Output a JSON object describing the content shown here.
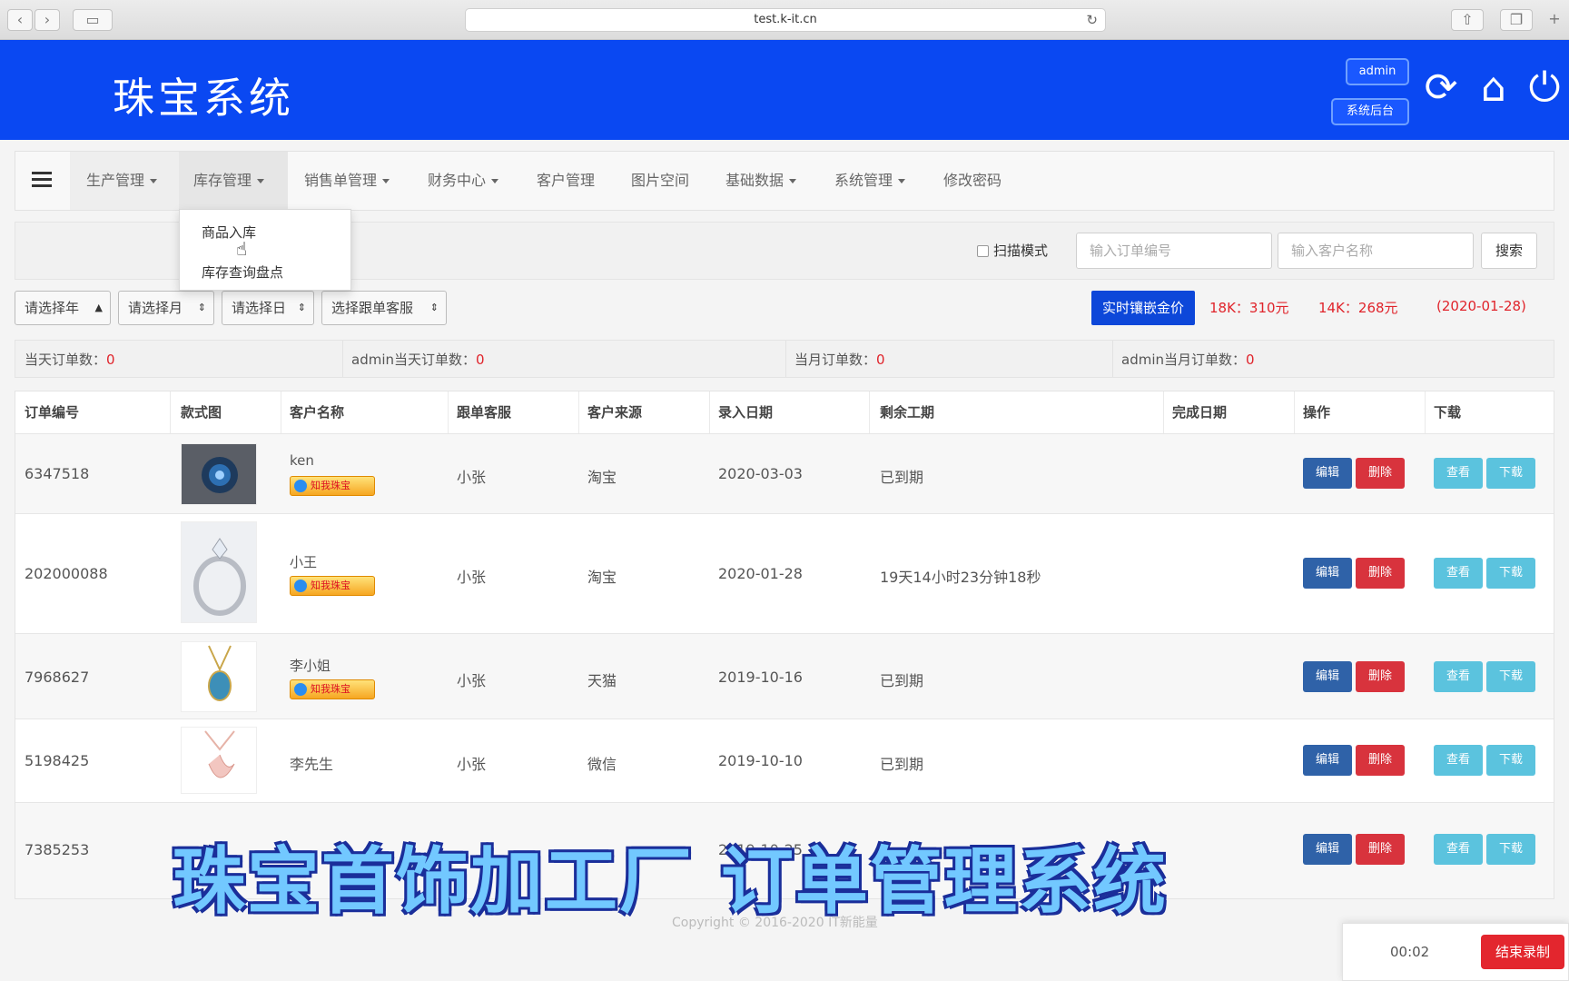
{
  "browser": {
    "url": "test.k-it.cn"
  },
  "header": {
    "title": "珠宝系统",
    "admin_label": "admin",
    "backend_label": "系统后台",
    "icons": [
      "refresh-icon",
      "home-icon",
      "power-icon"
    ]
  },
  "nav": {
    "items": [
      {
        "label": "生产管理",
        "dropdown": true
      },
      {
        "label": "库存管理",
        "dropdown": true,
        "active": true
      },
      {
        "label": "销售单管理",
        "dropdown": true
      },
      {
        "label": "财务中心",
        "dropdown": true
      },
      {
        "label": "客户管理",
        "dropdown": false
      },
      {
        "label": "图片空间",
        "dropdown": false
      },
      {
        "label": "基础数据",
        "dropdown": true
      },
      {
        "label": "系统管理",
        "dropdown": true
      },
      {
        "label": "修改密码",
        "dropdown": false
      }
    ],
    "open_dropdown": [
      "商品入库",
      "库存查询盘点"
    ]
  },
  "search": {
    "scan_mode_label": "扫描模式",
    "order_placeholder": "输入订单编号",
    "customer_placeholder": "输入客户名称",
    "button_label": "搜索"
  },
  "filters": {
    "year": "请选择年",
    "month": "请选择月",
    "day": "请选择日",
    "service": "选择跟单客服",
    "gold_price_button": "实时镶嵌金价",
    "k18": "18K：310元",
    "k14": "14K：268元",
    "date": "(2020-01-28)"
  },
  "stats": {
    "today_label": "当天订单数：",
    "today_value": "0",
    "admin_today_label": "admin当天订单数：",
    "admin_today_value": "0",
    "month_label": "当月订单数：",
    "month_value": "0",
    "admin_month_label": "admin当月订单数：",
    "admin_month_value": "0"
  },
  "table": {
    "columns": [
      "订单编号",
      "款式图",
      "客户名称",
      "跟单客服",
      "客户来源",
      "录入日期",
      "剩余工期",
      "完成日期",
      "操作",
      "下载"
    ],
    "badge_text": "知我珠宝",
    "actions": {
      "edit": "编辑",
      "delete": "删除",
      "view": "查看",
      "download": "下载"
    },
    "rows": [
      {
        "order": "6347518",
        "customer": "ken",
        "service": "小张",
        "source": "淘宝",
        "date": "2020-03-03",
        "remaining": "已到期",
        "done": "",
        "badge": true
      },
      {
        "order": "202000088",
        "customer": "小王",
        "service": "小张",
        "source": "淘宝",
        "date": "2020-01-28",
        "remaining": "19天14小时23分钟18秒",
        "done": "",
        "badge": true
      },
      {
        "order": "7968627",
        "customer": "李小姐",
        "service": "小张",
        "source": "天猫",
        "date": "2019-10-16",
        "remaining": "已到期",
        "done": "",
        "badge": true
      },
      {
        "order": "5198425",
        "customer": "李先生",
        "service": "小张",
        "source": "微信",
        "date": "2019-10-10",
        "remaining": "已到期",
        "done": "",
        "badge": false
      },
      {
        "order": "7385253",
        "customer": "",
        "service": "",
        "source": "",
        "date": "2019-10-25",
        "remaining": "",
        "done": "",
        "badge": false
      }
    ]
  },
  "footer": {
    "copyright": "Copyright © 2016-2020 IT新能量"
  },
  "caption": "珠宝首饰加工厂 订单管理系统",
  "recorder": {
    "time": "00:02",
    "stop_label": "结束录制"
  },
  "colors": {
    "header_blue": "#0a48f2",
    "price_red": "#e0242b",
    "edit_blue": "#2f62a8",
    "delete_red": "#d8333d",
    "view_cyan": "#5bc3de"
  }
}
